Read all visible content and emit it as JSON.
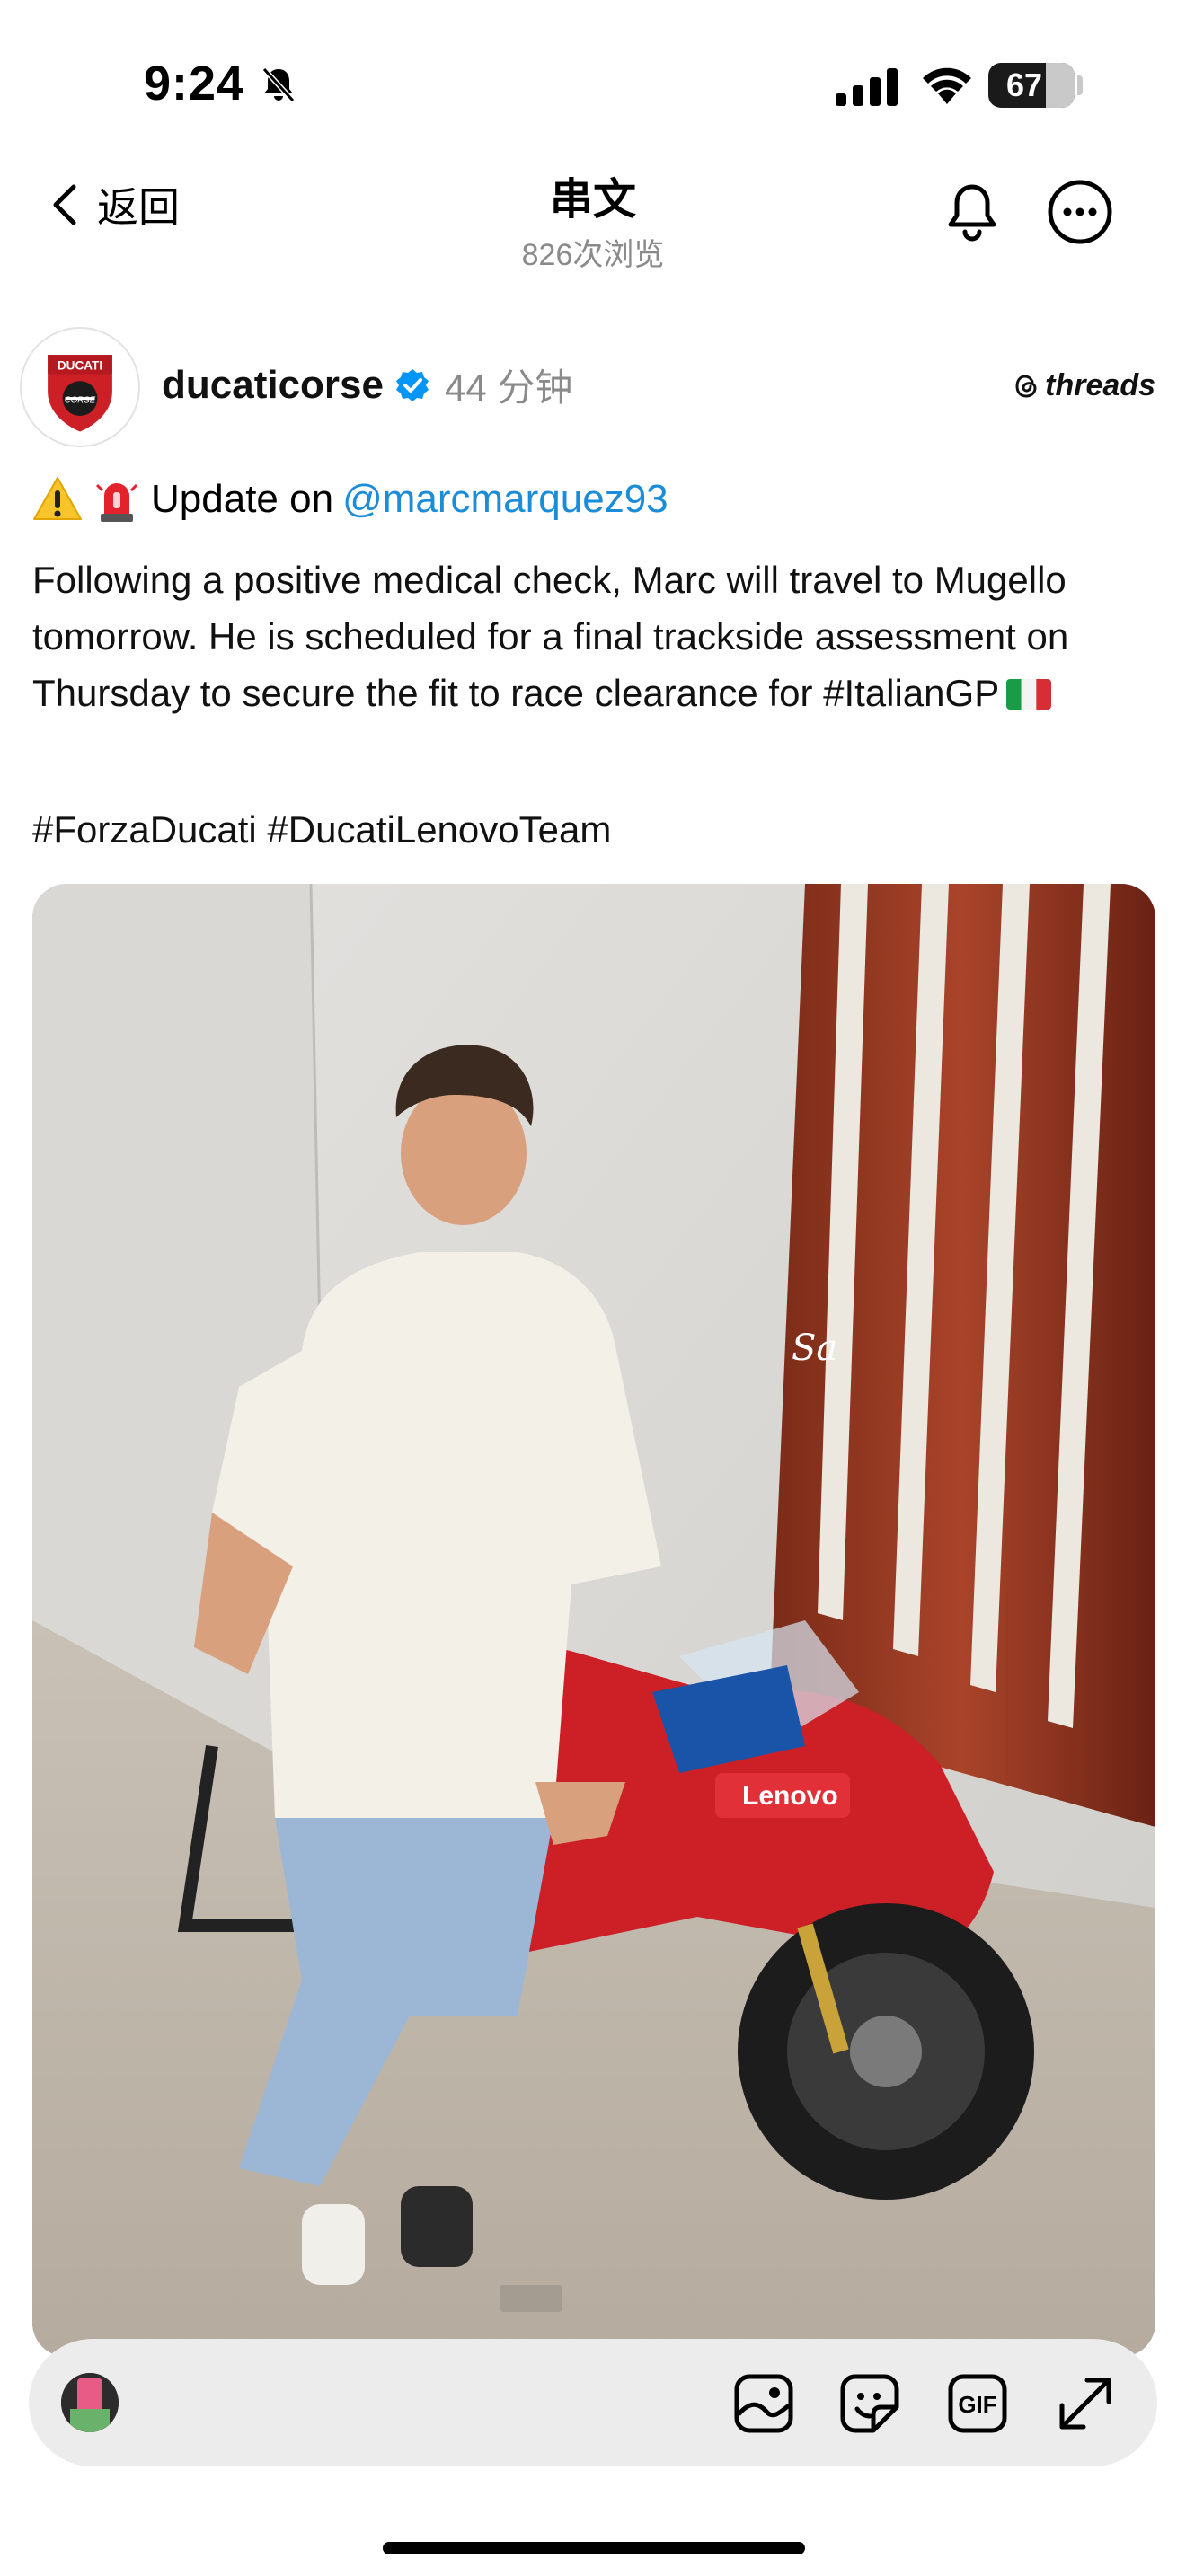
{
  "status_bar": {
    "time": "9:24",
    "battery": "67",
    "battery_level": 0.67
  },
  "nav": {
    "back_label": "返回",
    "title": "串文",
    "subtitle": "826次浏览"
  },
  "post": {
    "username": "ducaticorse",
    "time_ago": "44 分钟",
    "brand": "threads",
    "update_prefix": "Update on",
    "mention": "@marcmarquez93",
    "body": "Following a positive medical check, Marc will travel to Mugello tomorrow. He is scheduled for a final trackside assessment on Thursday to secure the fit to race clearance for #ItalianGP",
    "hashtags": "#ForzaDucati #DucatiLenovoTeam",
    "image_watermark": "Sa"
  },
  "composer": {
    "icons": [
      "gallery-icon",
      "sticker-icon",
      "gif-icon",
      "expand-icon"
    ],
    "gif_label": "GIF"
  },
  "colors": {
    "mention": "#1a8cd8",
    "verified": "#0095f6",
    "ducati_red": "#cc1f26"
  }
}
